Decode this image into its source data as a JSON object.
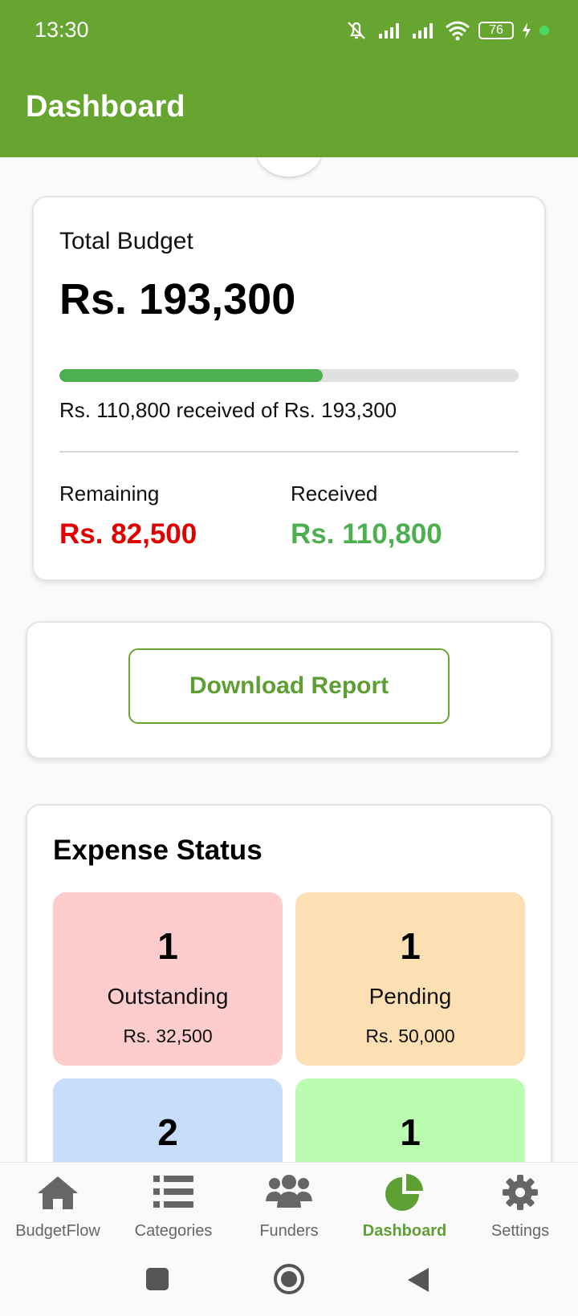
{
  "status_bar": {
    "time": "13:30",
    "battery": "76"
  },
  "header": {
    "title": "Dashboard"
  },
  "budget": {
    "label": "Total Budget",
    "total": "Rs. 193,300",
    "progress_fraction": 0.573,
    "progress_text": "Rs. 110,800 received of Rs. 193,300",
    "remaining_label": "Remaining",
    "remaining_value": "Rs. 82,500",
    "received_label": "Received",
    "received_value": "Rs. 110,800"
  },
  "report": {
    "button_label": "Download Report"
  },
  "expense_status": {
    "title": "Expense Status",
    "tiles": [
      {
        "count": "1",
        "label": "Outstanding",
        "amount": "Rs. 32,500",
        "color": "#fdcccc"
      },
      {
        "count": "1",
        "label": "Pending",
        "amount": "Rs. 50,000",
        "color": "#fce0b4"
      },
      {
        "count": "2",
        "color": "#c8dcfc"
      },
      {
        "count": "1",
        "color": "#bbfdb0"
      }
    ]
  },
  "nav": {
    "items": [
      {
        "label": "BudgetFlow",
        "icon": "home-icon"
      },
      {
        "label": "Categories",
        "icon": "list-icon"
      },
      {
        "label": "Funders",
        "icon": "people-icon"
      },
      {
        "label": "Dashboard",
        "icon": "pie-chart-icon",
        "active": true
      },
      {
        "label": "Settings",
        "icon": "gear-icon"
      }
    ]
  },
  "colors": {
    "brand": "#66a52f",
    "remaining": "#e00000",
    "received": "#4caf50",
    "nav_active": "#5e9f34",
    "nav_inactive": "#666666"
  }
}
